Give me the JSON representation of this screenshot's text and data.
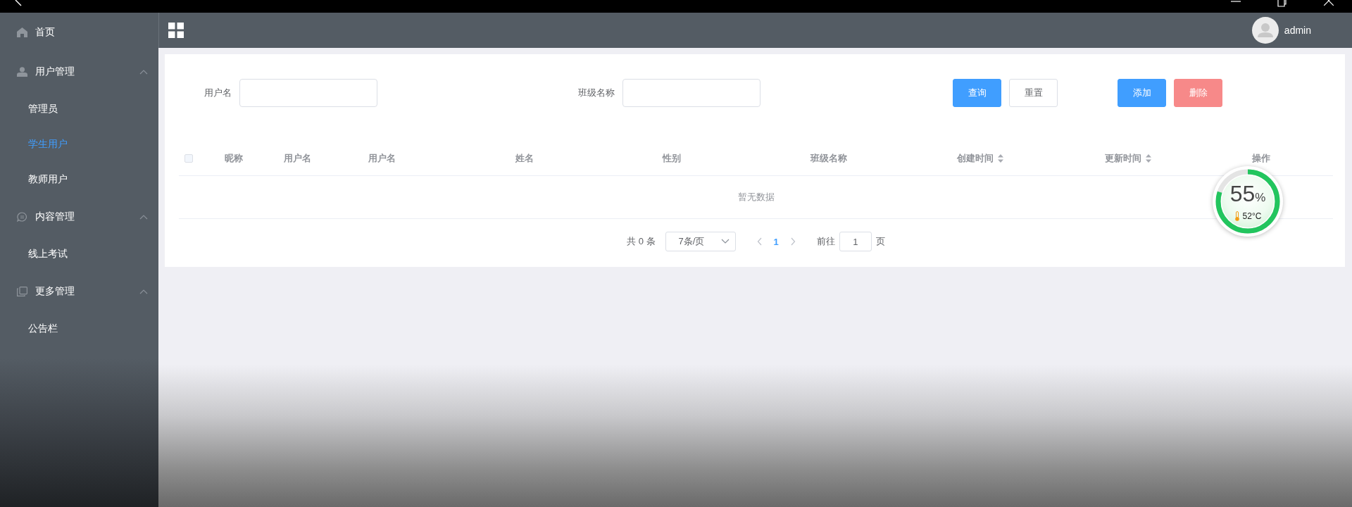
{
  "topbar": {
    "user": "admin"
  },
  "sidebar": {
    "items": [
      {
        "label": "首页",
        "selected": false
      },
      {
        "label": "用户管理",
        "expanded": true,
        "children": [
          {
            "label": "管理员",
            "selected": false
          },
          {
            "label": "学生用户",
            "selected": true
          },
          {
            "label": "教师用户",
            "selected": false
          }
        ]
      },
      {
        "label": "内容管理",
        "expanded": true,
        "children": [
          {
            "label": "线上考试",
            "selected": false
          }
        ]
      },
      {
        "label": "更多管理",
        "expanded": true,
        "children": [
          {
            "label": "公告栏",
            "selected": false
          }
        ]
      }
    ]
  },
  "filters": [
    {
      "label": "用户名"
    },
    {
      "label": "班级名称"
    }
  ],
  "search_buttons": [
    {
      "label": "查询",
      "kind": "primary"
    },
    {
      "label": "重置",
      "kind": "default"
    }
  ],
  "action_buttons": [
    {
      "label": "添加",
      "kind": "primary"
    },
    {
      "label": "删除",
      "kind": "danger"
    }
  ],
  "table": {
    "select_all_checked": false,
    "columns": [
      {
        "label": "昵称",
        "sortable": false
      },
      {
        "label": "用户名",
        "sortable": false
      },
      {
        "label": "用户名",
        "sortable": false
      },
      {
        "label": "姓名",
        "sortable": false
      },
      {
        "label": "性别",
        "sortable": false
      },
      {
        "label": "班级名称",
        "sortable": false
      },
      {
        "label": "创建时间",
        "sortable": true
      },
      {
        "label": "更新时间",
        "sortable": true
      },
      {
        "label": "操作",
        "sortable": false
      }
    ],
    "empty_text": "暂无数据"
  },
  "pagination": {
    "total": "共 0 条",
    "page_size": "7条/页",
    "pages": [
      {
        "label": "1",
        "selected": true
      }
    ],
    "goto_label": "前往",
    "goto_value": "1",
    "goto_suffix": "页"
  },
  "gauge": {
    "value": "55",
    "unit": "%",
    "temperature": "52°C",
    "level": 0.8
  }
}
